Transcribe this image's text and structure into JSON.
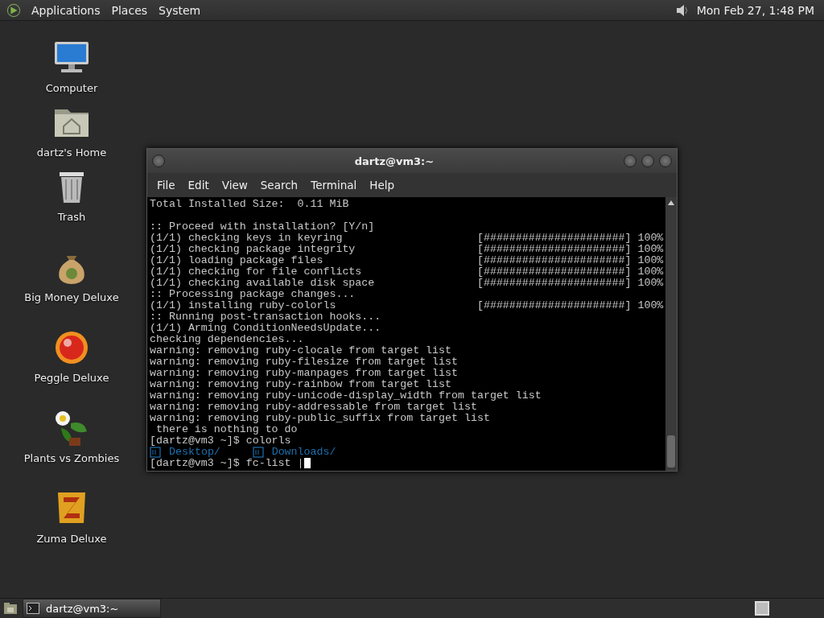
{
  "top_panel": {
    "menus": [
      "Applications",
      "Places",
      "System"
    ],
    "clock": "Mon Feb 27, 1:48 PM"
  },
  "desktop_icons": [
    {
      "label": "Computer",
      "kind": "computer"
    },
    {
      "label": "dartz's Home",
      "kind": "home"
    },
    {
      "label": "Trash",
      "kind": "trash"
    },
    {
      "label": "Big Money Deluxe",
      "kind": "money"
    },
    {
      "label": "Peggle Deluxe",
      "kind": "peggle"
    },
    {
      "label": "Plants vs Zombies",
      "kind": "plants"
    },
    {
      "label": "Zuma Deluxe",
      "kind": "zuma"
    }
  ],
  "terminal": {
    "title": "dartz@vm3:~",
    "menu": [
      "File",
      "Edit",
      "View",
      "Search",
      "Terminal",
      "Help"
    ],
    "lines": [
      {
        "kind": "text",
        "text": "Total Installed Size:  0.11 MiB"
      },
      {
        "kind": "blank"
      },
      {
        "kind": "text",
        "text": ":: Proceed with installation? [Y/n]"
      },
      {
        "kind": "progress",
        "text": "(1/1) checking keys in keyring",
        "bar": "[######################]",
        "percent": "100%"
      },
      {
        "kind": "progress",
        "text": "(1/1) checking package integrity",
        "bar": "[######################]",
        "percent": "100%"
      },
      {
        "kind": "progress",
        "text": "(1/1) loading package files",
        "bar": "[######################]",
        "percent": "100%"
      },
      {
        "kind": "progress",
        "text": "(1/1) checking for file conflicts",
        "bar": "[######################]",
        "percent": "100%"
      },
      {
        "kind": "progress",
        "text": "(1/1) checking available disk space",
        "bar": "[######################]",
        "percent": "100%"
      },
      {
        "kind": "text",
        "text": ":: Processing package changes..."
      },
      {
        "kind": "progress",
        "text": "(1/1) installing ruby-colorls",
        "bar": "[######################]",
        "percent": "100%"
      },
      {
        "kind": "text",
        "text": ":: Running post-transaction hooks..."
      },
      {
        "kind": "text",
        "text": "(1/1) Arming ConditionNeedsUpdate..."
      },
      {
        "kind": "text",
        "text": "checking dependencies..."
      },
      {
        "kind": "text",
        "text": "warning: removing ruby-clocale from target list"
      },
      {
        "kind": "text",
        "text": "warning: removing ruby-filesize from target list"
      },
      {
        "kind": "text",
        "text": "warning: removing ruby-manpages from target list"
      },
      {
        "kind": "text",
        "text": "warning: removing ruby-rainbow from target list"
      },
      {
        "kind": "text",
        "text": "warning: removing ruby-unicode-display_width from target list"
      },
      {
        "kind": "text",
        "text": "warning: removing ruby-addressable from target list"
      },
      {
        "kind": "text",
        "text": "warning: removing ruby-public_suffix from target list"
      },
      {
        "kind": "text",
        "text": " there is nothing to do"
      },
      {
        "kind": "text",
        "text": "[dartz@vm3 ~]$ colorls"
      },
      {
        "kind": "ls",
        "entries": [
          "Desktop/",
          "Downloads/"
        ]
      },
      {
        "kind": "prompt",
        "text": "[dartz@vm3 ~]$ fc-list |"
      }
    ]
  },
  "taskbar": {
    "tasks": [
      {
        "label": "dartz@vm3:~",
        "selected": true
      }
    ]
  }
}
